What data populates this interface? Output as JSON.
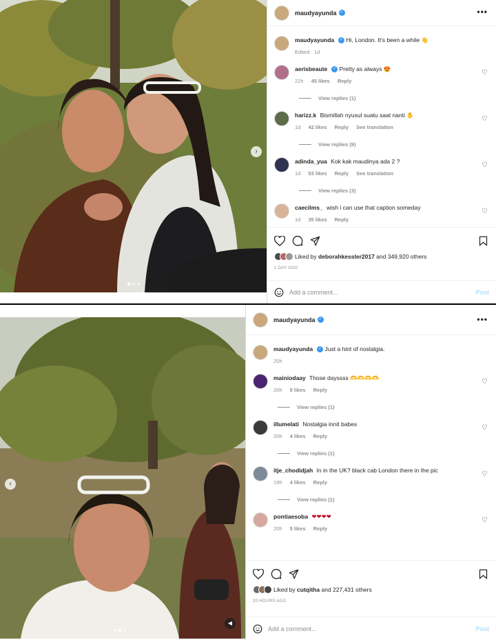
{
  "post1": {
    "username": "maudyayunda",
    "caption": {
      "user": "maudyayunda",
      "text": "Hi, London. It's been a while 👋",
      "meta": "Edited · 1d"
    },
    "comments": [
      {
        "user": "aerisbeaute",
        "verified": true,
        "text": "Pretty as always 😍",
        "time": "22h",
        "likes": "45 likes",
        "reply": "Reply",
        "translate": "",
        "view_replies": "View replies (1)"
      },
      {
        "user": "harizz.k",
        "verified": false,
        "text": "Bismillah nyusul suatu saat nanti ✋",
        "time": "1d",
        "likes": "42 likes",
        "reply": "Reply",
        "translate": "See translation",
        "view_replies": "View replies (9)"
      },
      {
        "user": "adinda_yua",
        "verified": false,
        "text": "Kok kak maudinya ada 2 ?",
        "time": "1d",
        "likes": "53 likes",
        "reply": "Reply",
        "translate": "See translation",
        "view_replies": "View replies (3)"
      },
      {
        "user": "caecilms_",
        "verified": false,
        "text": "wish i can use that caption someday",
        "time": "1d",
        "likes": "35 likes",
        "reply": "Reply",
        "translate": "",
        "view_replies": ""
      }
    ],
    "liked_prefix": "Liked by",
    "liked_user": "deborahkessler2017",
    "liked_rest": "and 349,920 others",
    "time_ago": "1 DAY AGO",
    "comment_placeholder": "Add a comment...",
    "post_label": "Post"
  },
  "post2": {
    "username": "maudyayunda",
    "caption": {
      "user": "maudyayunda",
      "text": "Just a hint of nostalgia.",
      "meta": "20h"
    },
    "comments": [
      {
        "user": "mainiodaay",
        "verified": false,
        "text": "Those dayssss 🫶🫶🫶🫶",
        "time": "20h",
        "likes": "5 likes",
        "reply": "Reply",
        "translate": "",
        "view_replies": "View replies (1)"
      },
      {
        "user": "illumelati",
        "verified": false,
        "text": "Nostalgia innit babes",
        "time": "20h",
        "likes": "4 likes",
        "reply": "Reply",
        "translate": "",
        "view_replies": "View replies (1)"
      },
      {
        "user": "itje_chodidjah",
        "verified": false,
        "text": "In in the UK? black cab London there in the pic",
        "time": "19h",
        "likes": "4 likes",
        "reply": "Reply",
        "translate": "",
        "view_replies": "View replies (1)"
      },
      {
        "user": "pontiaesoba",
        "verified": false,
        "text": "❤❤❤❤",
        "time": "20h",
        "likes": "5 likes",
        "reply": "Reply",
        "translate": "",
        "view_replies": ""
      }
    ],
    "liked_prefix": "Liked by",
    "liked_user": "cutqitha",
    "liked_rest": "and 227,431 others",
    "time_ago": "20 HOURS AGO",
    "comment_placeholder": "Add a comment...",
    "post_label": "Post"
  },
  "icons": [
    "heart-icon",
    "comment-icon",
    "share-icon",
    "bookmark-icon",
    "more-icon",
    "emoji-icon",
    "verified-icon",
    "chevron-right-icon",
    "chevron-left-icon",
    "sound-icon"
  ],
  "colors": {
    "verified": "#3897f0",
    "post_disabled": "#b2dffc",
    "muted": "#8e8e8e",
    "text": "#262626"
  }
}
